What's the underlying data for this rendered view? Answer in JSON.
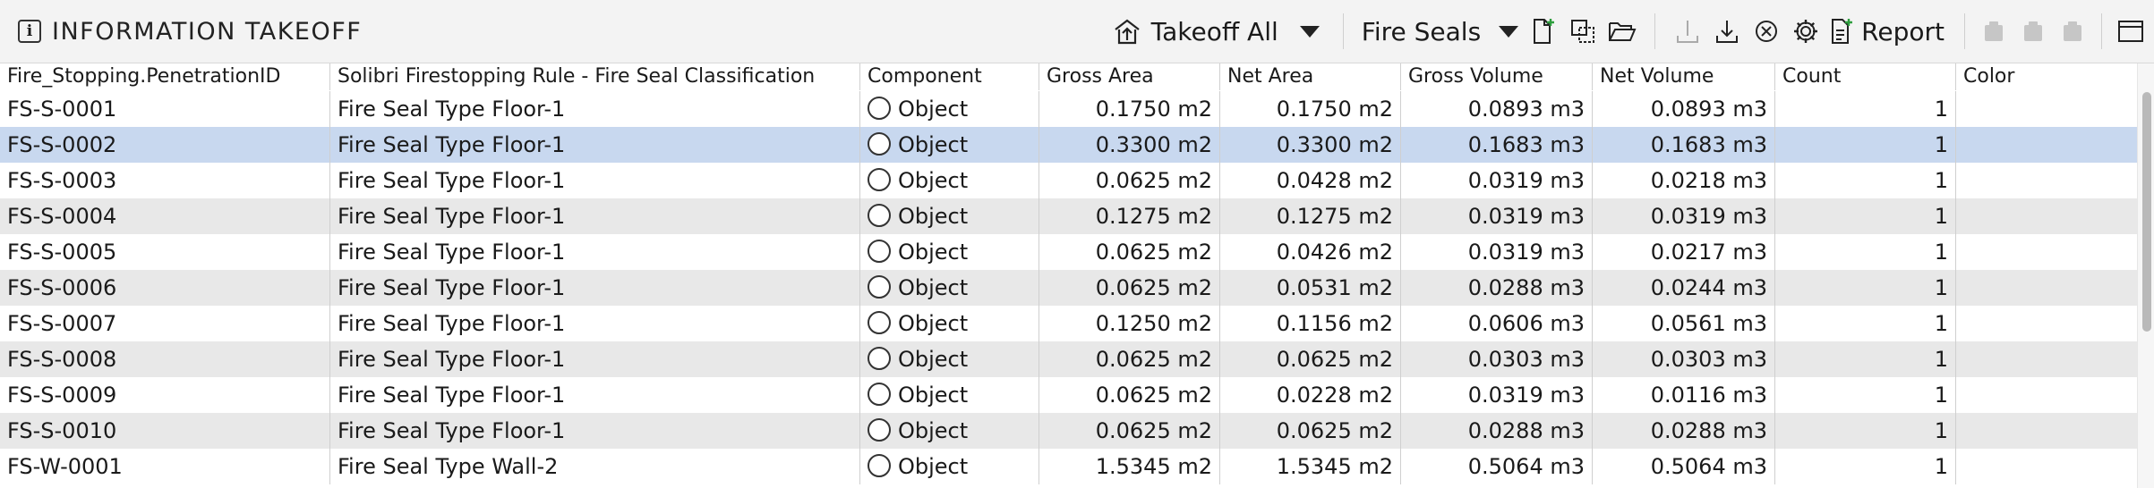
{
  "panel": {
    "title": "INFORMATION TAKEOFF",
    "title_icon": "info-icon"
  },
  "toolbar": {
    "takeoff_label": "Takeoff All",
    "set_label": "Fire Seals",
    "report_label": "Report",
    "icons": [
      "takeoff-icon",
      "new-set-icon",
      "copy-set-icon",
      "open-folder-icon",
      "export-icon",
      "export-all-icon",
      "clear-icon",
      "settings-icon",
      "report-icon",
      "disabled-icon-1",
      "disabled-icon-2",
      "disabled-icon-3",
      "maximize-icon"
    ]
  },
  "table": {
    "columns": [
      "Fire_Stopping.PenetrationID",
      "Solibri Firestopping Rule - Fire Seal Classification",
      "Component",
      "Gross Area",
      "Net Area",
      "Gross Volume",
      "Net Volume",
      "Count",
      "Color"
    ],
    "selected_row": 1,
    "rows": [
      {
        "id": "FS-S-0001",
        "classification": "Fire Seal Type Floor-1",
        "component": "Object",
        "gross_area": "0.1750 m2",
        "net_area": "0.1750 m2",
        "gross_volume": "0.0893 m3",
        "net_volume": "0.0893 m3",
        "count": "1",
        "color": ""
      },
      {
        "id": "FS-S-0002",
        "classification": "Fire Seal Type Floor-1",
        "component": "Object",
        "gross_area": "0.3300 m2",
        "net_area": "0.3300 m2",
        "gross_volume": "0.1683 m3",
        "net_volume": "0.1683 m3",
        "count": "1",
        "color": ""
      },
      {
        "id": "FS-S-0003",
        "classification": "Fire Seal Type Floor-1",
        "component": "Object",
        "gross_area": "0.0625 m2",
        "net_area": "0.0428 m2",
        "gross_volume": "0.0319 m3",
        "net_volume": "0.0218 m3",
        "count": "1",
        "color": ""
      },
      {
        "id": "FS-S-0004",
        "classification": "Fire Seal Type Floor-1",
        "component": "Object",
        "gross_area": "0.1275 m2",
        "net_area": "0.1275 m2",
        "gross_volume": "0.0319 m3",
        "net_volume": "0.0319 m3",
        "count": "1",
        "color": ""
      },
      {
        "id": "FS-S-0005",
        "classification": "Fire Seal Type Floor-1",
        "component": "Object",
        "gross_area": "0.0625 m2",
        "net_area": "0.0426 m2",
        "gross_volume": "0.0319 m3",
        "net_volume": "0.0217 m3",
        "count": "1",
        "color": ""
      },
      {
        "id": "FS-S-0006",
        "classification": "Fire Seal Type Floor-1",
        "component": "Object",
        "gross_area": "0.0625 m2",
        "net_area": "0.0531 m2",
        "gross_volume": "0.0288 m3",
        "net_volume": "0.0244 m3",
        "count": "1",
        "color": ""
      },
      {
        "id": "FS-S-0007",
        "classification": "Fire Seal Type Floor-1",
        "component": "Object",
        "gross_area": "0.1250 m2",
        "net_area": "0.1156 m2",
        "gross_volume": "0.0606 m3",
        "net_volume": "0.0561 m3",
        "count": "1",
        "color": ""
      },
      {
        "id": "FS-S-0008",
        "classification": "Fire Seal Type Floor-1",
        "component": "Object",
        "gross_area": "0.0625 m2",
        "net_area": "0.0625 m2",
        "gross_volume": "0.0303 m3",
        "net_volume": "0.0303 m3",
        "count": "1",
        "color": ""
      },
      {
        "id": "FS-S-0009",
        "classification": "Fire Seal Type Floor-1",
        "component": "Object",
        "gross_area": "0.0625 m2",
        "net_area": "0.0228 m2",
        "gross_volume": "0.0319 m3",
        "net_volume": "0.0116 m3",
        "count": "1",
        "color": ""
      },
      {
        "id": "FS-S-0010",
        "classification": "Fire Seal Type Floor-1",
        "component": "Object",
        "gross_area": "0.0625 m2",
        "net_area": "0.0625 m2",
        "gross_volume": "0.0288 m3",
        "net_volume": "0.0288 m3",
        "count": "1",
        "color": ""
      },
      {
        "id": "FS-W-0001",
        "classification": "Fire Seal Type Wall-2",
        "component": "Object",
        "gross_area": "1.5345 m2",
        "net_area": "1.5345 m2",
        "gross_volume": "0.5064 m3",
        "net_volume": "0.5064 m3",
        "count": "1",
        "color": ""
      }
    ]
  },
  "colors": {
    "selected_row": "#c8d8ef",
    "alt_row": "#e8e8e8",
    "accent_green": "#2e9e3e"
  }
}
